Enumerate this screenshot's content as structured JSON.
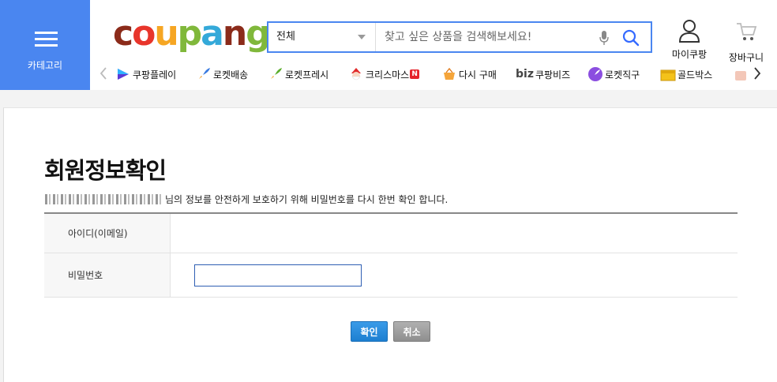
{
  "header": {
    "category_label": "카테고리",
    "logo": {
      "text": "coupang",
      "colors": [
        "#8b2b1a",
        "#e8352b",
        "#f6a623",
        "#80b83b",
        "#34a9d9"
      ]
    },
    "search": {
      "category_selected": "전체",
      "placeholder": "찾고 싶은 상품을 검색해보세요!",
      "value": ""
    },
    "mypage_label": "마이쿠팡",
    "cart_label": "장바구니",
    "accent_color": "#4a86f0"
  },
  "quicknav": {
    "items": [
      {
        "label": "쿠팡플레이",
        "icon": "play-icon"
      },
      {
        "label": "로켓배송",
        "icon": "rocket-blue-icon"
      },
      {
        "label": "로켓프레시",
        "icon": "rocket-green-icon"
      },
      {
        "label": "크리스마스",
        "icon": "santa-icon",
        "badge": "N"
      },
      {
        "label": "다시 구매",
        "icon": "basket-icon"
      },
      {
        "label": "쿠팡비즈",
        "icon": "biz-logo-icon",
        "prefix": "biz"
      },
      {
        "label": "로켓직구",
        "icon": "rocket-purple-icon"
      },
      {
        "label": "골드박스",
        "icon": "goldbox-icon"
      }
    ]
  },
  "page": {
    "title": "회원정보확인",
    "description": "님의 정보를 안전하게 보호하기 위해 비밀번호를 다시 한번 확인 합니다.",
    "form": {
      "id_label": "아이디(이메일)",
      "id_value": "",
      "password_label": "비밀번호",
      "password_value": ""
    },
    "confirm_label": "확인",
    "cancel_label": "취소"
  }
}
